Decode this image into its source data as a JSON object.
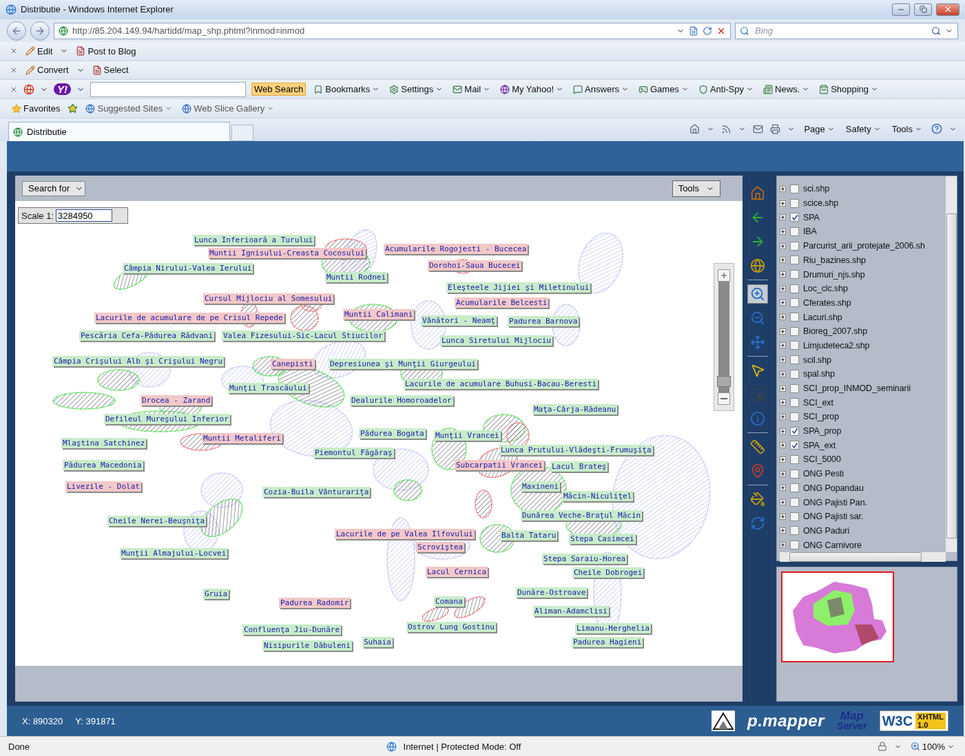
{
  "window": {
    "title": "Distributie - Windows Internet Explorer"
  },
  "address_bar": {
    "url": "http://85.204.149.94/hartidd/map_shp.phtml?inmod=inmod"
  },
  "search_box": {
    "placeholder": "Bing"
  },
  "toolbars": [
    {
      "items": [
        "Edit",
        "Post to Blog"
      ]
    },
    {
      "items": [
        "Convert",
        "Select"
      ]
    }
  ],
  "yahoo_toolbar": {
    "logo": "Y!",
    "search_button": "Web Search",
    "items": [
      "Bookmarks",
      "Settings",
      "Mail",
      "My Yahoo!",
      "Answers",
      "Games",
      "Anti-Spy",
      "News.",
      "Shopping"
    ]
  },
  "favorites_bar": {
    "favorites": "Favorites",
    "items": [
      "Suggested Sites",
      "Web Slice Gallery"
    ]
  },
  "tabs": [
    {
      "label": "Distributie",
      "selected": true
    }
  ],
  "command_bar": [
    "Page",
    "Safety",
    "Tools"
  ],
  "map": {
    "search_select": "Search for",
    "tools_button": "Tools",
    "scale_label": "Scale 1:",
    "scale_value": "3284950",
    "zoom_slider": {
      "level": 0.05
    },
    "labels": [
      {
        "text": "Lunca Inferioară a Turului",
        "color": "#c8ecca"
      },
      {
        "text": "Muntii Ignisului-Creasta Cocosului",
        "color": "#f2c8c8"
      },
      {
        "text": "Câmpia Nirului-Valea Ierului",
        "color": "#c8ecca"
      },
      {
        "text": "Muntii Rodnei",
        "color": "#c8ecca"
      },
      {
        "text": "Acumularile Rogojesti - Bucecea",
        "color": "#f2c8c8"
      },
      {
        "text": "Dorohoi-Saua Bucecei",
        "color": "#f2c8c8"
      },
      {
        "text": "Eleşteele Jijiei şi Miletinului",
        "color": "#c8ecca"
      },
      {
        "text": "Cursul Mijlociu al Somesului",
        "color": "#f2c8c8"
      },
      {
        "text": "Acumularile Belcesti",
        "color": "#f2c8c8"
      },
      {
        "text": "Lacurile de acumulare de pe Crisul Repede",
        "color": "#f2c8c8"
      },
      {
        "text": "Muntii Calimani",
        "color": "#f2c8c8"
      },
      {
        "text": "Vânători - Neamţ",
        "color": "#c8ecca"
      },
      {
        "text": "Padurea Barnova",
        "color": "#c8ecca"
      },
      {
        "text": "Pescăria Cefa-Pădurea Rădvani",
        "color": "#c8ecca"
      },
      {
        "text": "Valea Fizesului-Sic-Lacul Stiucilor",
        "color": "#c8ecca"
      },
      {
        "text": "Lunca Siretului Mijlociu",
        "color": "#c8ecca"
      },
      {
        "text": "Câmpia Crişului Alb şi Crişului Negru",
        "color": "#c8ecca"
      },
      {
        "text": "Canepisti",
        "color": "#f2c8c8"
      },
      {
        "text": "Depresiunea şi Munţii Giurgeului",
        "color": "#c8ecca"
      },
      {
        "text": "Lacurile de acumulare Buhusi-Bacau-Beresti",
        "color": "#c8ecca"
      },
      {
        "text": "Munţii Trascăului",
        "color": "#c8ecca"
      },
      {
        "text": "Drocea - Zarand",
        "color": "#f2c8c8"
      },
      {
        "text": "Dealurile Homoroadelor",
        "color": "#c8ecca"
      },
      {
        "text": "Maţa-Cârja-Rădeanu",
        "color": "#c8ecca"
      },
      {
        "text": "Defileul Mureşului Inferior",
        "color": "#c8ecca"
      },
      {
        "text": "Mlaştina Satchinez",
        "color": "#c8ecca"
      },
      {
        "text": "Muntii Metaliferi",
        "color": "#f2c8c8"
      },
      {
        "text": "Pădurea Bogata",
        "color": "#c8ecca"
      },
      {
        "text": "Munţii Vrancei",
        "color": "#c8ecca"
      },
      {
        "text": "Piemontul Făgăraş",
        "color": "#c8ecca"
      },
      {
        "text": "Lunca Prutului-Vlădeşti-Frumuşiţa",
        "color": "#c8ecca"
      },
      {
        "text": "Pădurea Macedonia",
        "color": "#c8ecca"
      },
      {
        "text": "Subcarpatii Vrancei",
        "color": "#f2c8c8"
      },
      {
        "text": "Lacul Brateş",
        "color": "#c8ecca"
      },
      {
        "text": "Livezile - Dolat",
        "color": "#f2c8c8"
      },
      {
        "text": "Cozia-Buila Vânturariţa",
        "color": "#c8ecca"
      },
      {
        "text": "Maxineni",
        "color": "#c8ecca"
      },
      {
        "text": "Măcin-Niculiţel",
        "color": "#c8ecca"
      },
      {
        "text": "Cheile Nerei-Beuşniţa",
        "color": "#c8ecca"
      },
      {
        "text": "Dunărea Veche-Braţul Măcin",
        "color": "#c8ecca"
      },
      {
        "text": "Lacurile de pe Valea Ilfovului",
        "color": "#f2c8c8"
      },
      {
        "text": "Balta Tataru",
        "color": "#c8ecca"
      },
      {
        "text": "Stepa Casimcei",
        "color": "#c8ecca"
      },
      {
        "text": "Munţii Almajului-Locvei",
        "color": "#c8ecca"
      },
      {
        "text": "Scroviştea",
        "color": "#f2c8c8"
      },
      {
        "text": "Stepa Saraiu-Horea",
        "color": "#c8ecca"
      },
      {
        "text": "Lacul Cernica",
        "color": "#f2c8c8"
      },
      {
        "text": "Cheile Dobrogei",
        "color": "#c8ecca"
      },
      {
        "text": "Gruia",
        "color": "#c8ecca"
      },
      {
        "text": "Dunăre-Ostroave",
        "color": "#c8ecca"
      },
      {
        "text": "Padurea Radomir",
        "color": "#f2c8c8"
      },
      {
        "text": "Comana",
        "color": "#c8ecca"
      },
      {
        "text": "Aliman-Adamclisi",
        "color": "#c8ecca"
      },
      {
        "text": "Confluenţa Jiu-Dunăre",
        "color": "#c8ecca"
      },
      {
        "text": "Ostrov Lung Gostinu",
        "color": "#c8ecca"
      },
      {
        "text": "Limanu-Herghelia",
        "color": "#c8ecca"
      },
      {
        "text": "Nisipurile Dăbuleni",
        "color": "#c8ecca"
      },
      {
        "text": "Suhaia",
        "color": "#c8ecca"
      },
      {
        "text": "Padurea Hagieni",
        "color": "#c8ecca"
      }
    ],
    "tool_groups": [
      [
        {
          "kind": "home",
          "selected": false
        },
        {
          "kind": "back",
          "selected": false
        },
        {
          "kind": "forward",
          "selected": false
        },
        {
          "kind": "extent",
          "selected": false
        }
      ],
      [
        {
          "kind": "zoomin",
          "selected": true
        },
        {
          "kind": "zoomout",
          "selected": false
        },
        {
          "kind": "pan",
          "selected": false
        }
      ],
      [
        {
          "kind": "identify",
          "selected": false
        },
        {
          "kind": "select",
          "selected": false
        },
        {
          "kind": "info",
          "selected": false
        }
      ],
      [
        {
          "kind": "measure",
          "selected": false
        },
        {
          "kind": "poi",
          "selected": false
        }
      ],
      [
        {
          "kind": "print",
          "selected": false
        },
        {
          "kind": "refresh",
          "selected": false
        }
      ]
    ],
    "layers": [
      {
        "name": "sci.shp",
        "checked": false
      },
      {
        "name": "scice.shp",
        "checked": false
      },
      {
        "name": "SPA",
        "checked": true
      },
      {
        "name": "IBA",
        "checked": false
      },
      {
        "name": "Parcurist_arii_protejate_2006.sh",
        "checked": false
      },
      {
        "name": "Riu_bazines.shp",
        "checked": false
      },
      {
        "name": "Drumuri_njs.shp",
        "checked": false
      },
      {
        "name": "Loc_clc.shp",
        "checked": false
      },
      {
        "name": "Cferates.shp",
        "checked": false
      },
      {
        "name": "Lacuri.shp",
        "checked": false
      },
      {
        "name": "Bioreg_2007.shp",
        "checked": false
      },
      {
        "name": "Limjudeteca2.shp",
        "checked": false
      },
      {
        "name": "scil.shp",
        "checked": false
      },
      {
        "name": "spal.shp",
        "checked": false
      },
      {
        "name": "SCI_prop_INMOD_seminarii",
        "checked": false
      },
      {
        "name": "SCI_ext",
        "checked": false
      },
      {
        "name": "SCI_prop",
        "checked": false
      },
      {
        "name": "SPA_prop",
        "checked": true
      },
      {
        "name": "SPA_ext",
        "checked": true
      },
      {
        "name": "SCI_5000",
        "checked": false
      },
      {
        "name": "ONG Pesti",
        "checked": false
      },
      {
        "name": "ONG Popandau",
        "checked": false
      },
      {
        "name": "ONG Pajisti Pan.",
        "checked": false
      },
      {
        "name": "ONG Pajisti sar.",
        "checked": false
      },
      {
        "name": "ONG Paduri",
        "checked": false
      },
      {
        "name": "ONG Carnivore",
        "checked": false
      }
    ],
    "coordinates": {
      "x": "X: 890320",
      "y": "Y: 391871"
    },
    "logos": {
      "pmapper": "p.mapper",
      "mapserver_top": "Map",
      "mapserver_bottom": "Server",
      "w3c": "W3C",
      "xhtml": "XHTML",
      "xhtml_version": "1.0"
    }
  },
  "status_bar": {
    "status": "Done",
    "zone": "Internet | Protected Mode: Off",
    "zoom": "100%"
  }
}
